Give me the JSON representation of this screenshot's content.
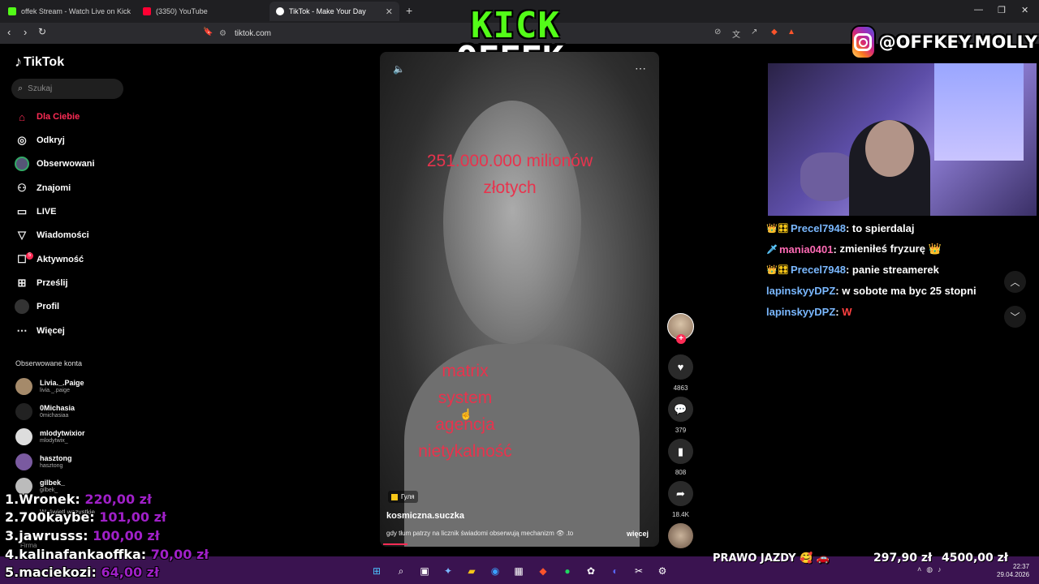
{
  "browser": {
    "tabs": [
      {
        "title": "offek Stream - Watch Live on Kick",
        "color": "#53fc18"
      },
      {
        "title": "(3350) YouTube",
        "color": "#ff0033"
      },
      {
        "title": "TikTok - Make Your Day",
        "color": "#ffffff",
        "active": true
      }
    ],
    "url": "tiktok.com"
  },
  "overlay": {
    "kick": "KICK",
    "offek": "OFFEK",
    "instagram": "@OFFKEY.MOLLY"
  },
  "sidebar": {
    "logo": "TikTok",
    "search_placeholder": "Szukaj",
    "nav": [
      {
        "label": "Dla Ciebie",
        "icon": "home-icon",
        "active": true
      },
      {
        "label": "Odkryj",
        "icon": "compass-icon"
      },
      {
        "label": "Obserwowani",
        "icon": "avatar-icon"
      },
      {
        "label": "Znajomi",
        "icon": "friends-icon"
      },
      {
        "label": "LIVE",
        "icon": "live-icon"
      },
      {
        "label": "Wiadomości",
        "icon": "messages-icon"
      },
      {
        "label": "Aktywność",
        "icon": "activity-icon",
        "badge": "5"
      },
      {
        "label": "Prześlij",
        "icon": "upload-icon"
      },
      {
        "label": "Profil",
        "icon": "profile-icon"
      },
      {
        "label": "Więcej",
        "icon": "more-icon"
      }
    ],
    "followed_title": "Obserwowane konta",
    "followed": [
      {
        "name": "Livia._.Paige",
        "handle": "livia._.paige"
      },
      {
        "name": "0Michasia",
        "handle": "0michasiaa"
      },
      {
        "name": "mlodytwixior",
        "handle": "mlodytwix_"
      },
      {
        "name": "hasztong",
        "handle": "hasztong"
      },
      {
        "name": "gilbek_",
        "handle": "gilbek_"
      }
    ],
    "show_all": "Wyświetl wszystkie",
    "footer": "Firma"
  },
  "video": {
    "caption_top": [
      "251.000.000 milionów",
      "złotych"
    ],
    "caption_bottom": [
      "matrix",
      "system",
      "agencja",
      "nietykalność"
    ],
    "tag": "Гуля",
    "author": "kosmiczna.suczka",
    "description": "gdy tłum patrzy na licznik świadomi obserwują mechanizm 👁 .to",
    "more": "więcej",
    "likes": "4863",
    "comments": "379",
    "saves": "808",
    "shares": "18.4K"
  },
  "chat": [
    {
      "badges": "👑🎛",
      "user": "Precel7948",
      "message": "to spierdalaj",
      "user_color": "blue"
    },
    {
      "badges": "🗡",
      "user": "mania0401",
      "message": "zmieniłeś fryzurę 👑",
      "user_color": "pink"
    },
    {
      "badges": "👑🎛",
      "user": "Precel7948",
      "message": "panie streamerek",
      "user_color": "blue"
    },
    {
      "badges": "",
      "user": "lapinskyyDPZ",
      "message": "w sobote ma byc 25 stopni",
      "user_color": "blue"
    },
    {
      "badges": "",
      "user": "lapinskyyDPZ",
      "message": "W",
      "user_color": "blue",
      "red": true
    }
  ],
  "donations": [
    {
      "rank": "1.",
      "name": "Wronek:",
      "amount": "220,00 zł"
    },
    {
      "rank": "2.",
      "name": "700kaybe:",
      "amount": "101,00 zł"
    },
    {
      "rank": "3.",
      "name": "jawrusss:",
      "amount": "100,00 zł"
    },
    {
      "rank": "4.",
      "name": "kalinafankaoffka:",
      "amount": "70,00 zł"
    },
    {
      "rank": "5.",
      "name": "maciekozi:",
      "amount": "64,00 zł"
    }
  ],
  "goal": {
    "label": "PRAWO JAZDY 🥰 🚗",
    "current": "297,90 zł",
    "target": "4500,00 zł"
  },
  "taskbar": {
    "time": "22:37",
    "date": "29.04.2026"
  }
}
